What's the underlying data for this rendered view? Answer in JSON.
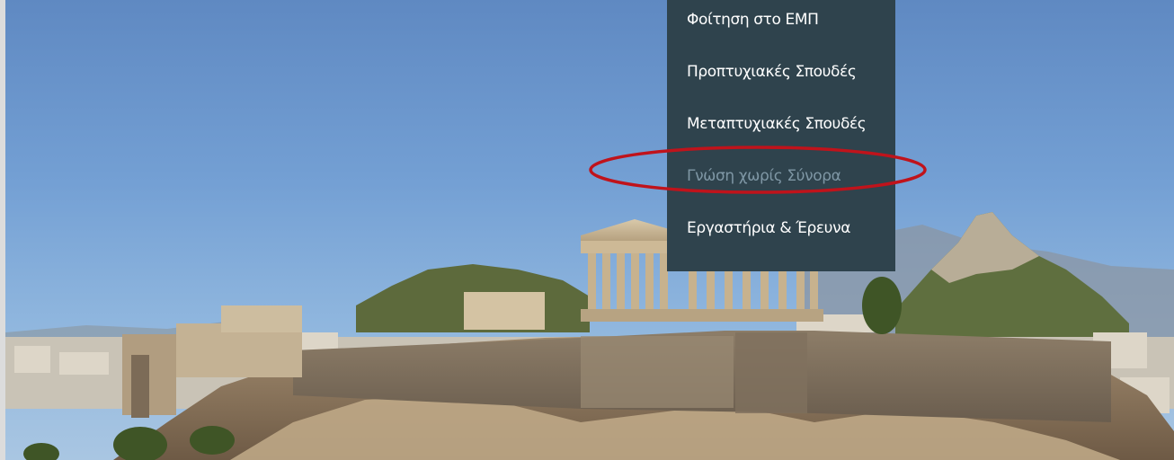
{
  "dropdown": {
    "items": [
      {
        "label": "Φοίτηση στο ΕΜΠ",
        "active": false
      },
      {
        "label": "Προπτυχιακές Σπουδές",
        "active": false
      },
      {
        "label": "Μεταπτυχιακές Σπουδές",
        "active": false
      },
      {
        "label": "Γνώση χωρίς Σύνορα",
        "active": true
      },
      {
        "label": "Εργαστήρια & Έρευνα",
        "active": false
      }
    ]
  },
  "colors": {
    "menu_background": "#2f434d",
    "menu_text": "#ffffff",
    "menu_text_active": "#7f97a5",
    "highlight_ring": "#c0131b",
    "sky": "#74a0d4"
  },
  "hero": {
    "image_subject": "acropolis-photo"
  }
}
